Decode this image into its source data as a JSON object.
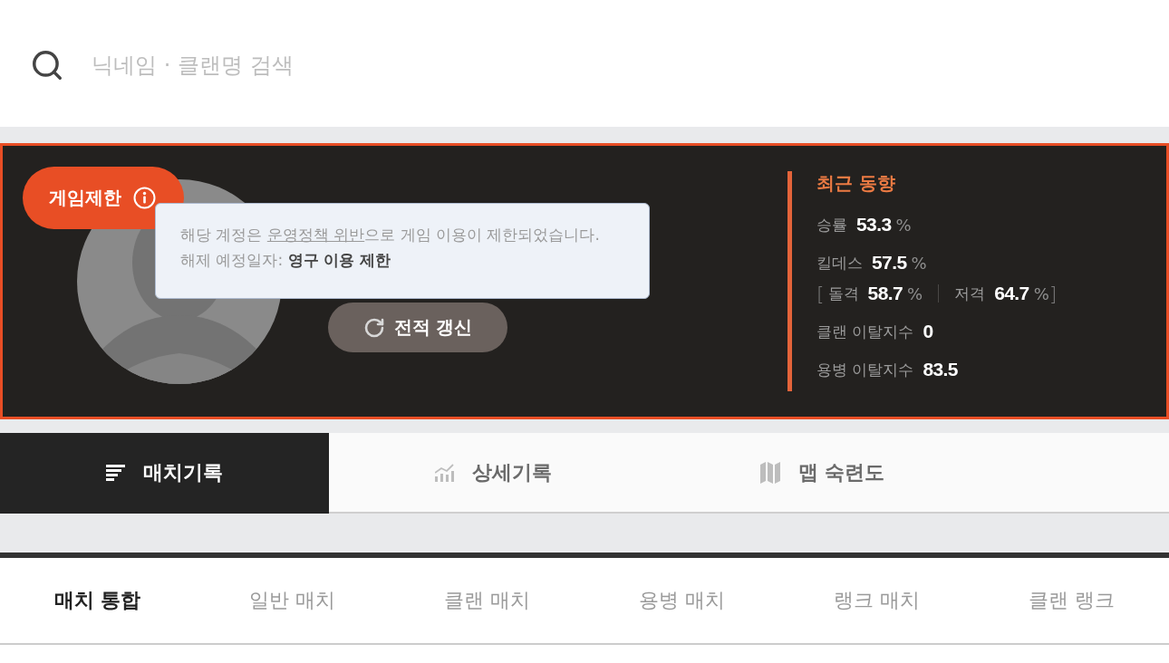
{
  "search": {
    "placeholder": "닉네임 · 클랜명 검색"
  },
  "profile": {
    "restriction_badge": {
      "label": "게임제한"
    },
    "restriction_tooltip": {
      "message_before": "해당 계정은 ",
      "policy_link": "운영정책 위반",
      "message_after": "으로 게임 이용이 제한되었습니다.",
      "release_date": "해제 예정일자: **영구 이용 제한**"
    },
    "refresh_button": {
      "label": "전적 갱신"
    }
  },
  "recent_trend": {
    "title": "최근 동향",
    "stats": [
      {
        "kind": "single",
        "label": "승률",
        "value": "53.3",
        "unit": "%"
      },
      {
        "kind": "single",
        "label": "킬데스",
        "value": "57.5",
        "unit": "%"
      },
      {
        "kind": "split",
        "open": "[",
        "close": "]",
        "parts": [
          {
            "label": "돌격",
            "value": "58.7",
            "unit": "%"
          },
          {
            "label": "저격",
            "value": "64.7",
            "unit": "%"
          }
        ]
      },
      {
        "kind": "single",
        "label": "클랜 이탈지수",
        "value": "0"
      },
      {
        "kind": "single",
        "label": "용병 이탈지수",
        "value": "83.5"
      }
    ]
  },
  "tabs": [
    {
      "label": "매치기록",
      "selected": true
    },
    {
      "label": "상세기록",
      "selected": false
    },
    {
      "label": "맵 숙련도",
      "selected": false
    }
  ],
  "match_filters": [
    {
      "label": "매치 통합",
      "selected": true
    },
    {
      "label": "일반 매치",
      "selected": false
    },
    {
      "label": "클랜 매치",
      "selected": false
    },
    {
      "label": "용병 매치",
      "selected": false
    },
    {
      "label": "랭크 매치",
      "selected": false
    },
    {
      "label": "클랜 랭크",
      "selected": false
    }
  ]
}
